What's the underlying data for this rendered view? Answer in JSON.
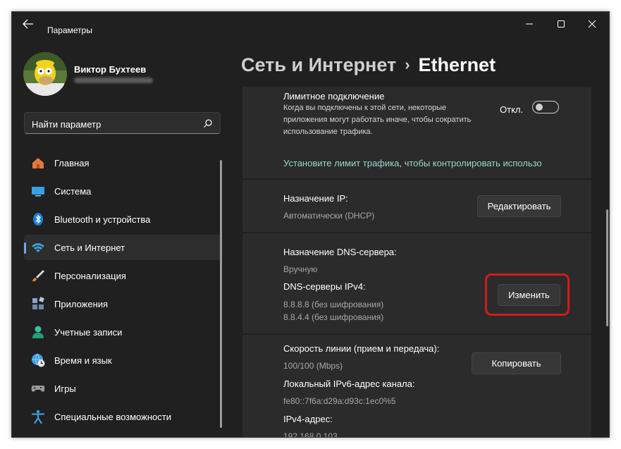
{
  "window": {
    "title": "Параметры"
  },
  "user": {
    "name": "Виктор Бухтеев"
  },
  "search": {
    "placeholder": "Найти параметр"
  },
  "nav": [
    {
      "label": "Главная",
      "icon": "home-icon",
      "active": false
    },
    {
      "label": "Система",
      "icon": "monitor-icon",
      "active": false
    },
    {
      "label": "Bluetooth и устройства",
      "icon": "bluetooth-icon",
      "active": false
    },
    {
      "label": "Сеть и Интернет",
      "icon": "wifi-icon",
      "active": true
    },
    {
      "label": "Персонализация",
      "icon": "brush-icon",
      "active": false
    },
    {
      "label": "Приложения",
      "icon": "apps-icon",
      "active": false
    },
    {
      "label": "Учетные записи",
      "icon": "person-icon",
      "active": false
    },
    {
      "label": "Время и язык",
      "icon": "globe-clock-icon",
      "active": false
    },
    {
      "label": "Игры",
      "icon": "gamepad-icon",
      "active": false
    },
    {
      "label": "Специальные возможности",
      "icon": "accessibility-icon",
      "active": false
    }
  ],
  "breadcrumb": {
    "parent": "Сеть и Интернет",
    "separator": "›",
    "current": "Ethernet"
  },
  "metered": {
    "title": "Лимитное подключение",
    "description": "Когда вы подключены к этой сети, некоторые приложения могут работать иначе, чтобы сократить использование трафика.",
    "toggle_state": "Откл.",
    "toggle_on": false,
    "link": "Установите лимит трафика, чтобы контролировать использо"
  },
  "ip": {
    "title": "Назначение IP:",
    "value": "Автоматически (DHCP)",
    "button": "Редактировать"
  },
  "dns": {
    "title": "Назначение DNS-сервера:",
    "value": "Вручную",
    "servers_title": "DNS-серверы IPv4:",
    "server1": "8.8.8.8 (без шифрования)",
    "server2": "8.8.4.4 (без шифрования)",
    "button": "Изменить"
  },
  "props": {
    "speed_title": "Скорость линии (прием и передача):",
    "speed_value": "100/100 (Mbps)",
    "ipv6_title": "Локальный IPv6-адрес канала:",
    "ipv6_value": "fe80::7f6a:d29a:d93c:1ec0%5",
    "ipv4_title": "IPv4-адрес:",
    "ipv4_value": "192.168.0.103",
    "button": "Копировать"
  },
  "colors": {
    "accent": "#7aa7d9",
    "link": "#99d6c8",
    "highlight": "#d01c1c",
    "background": "#202020",
    "card": "#2b2b2b"
  }
}
